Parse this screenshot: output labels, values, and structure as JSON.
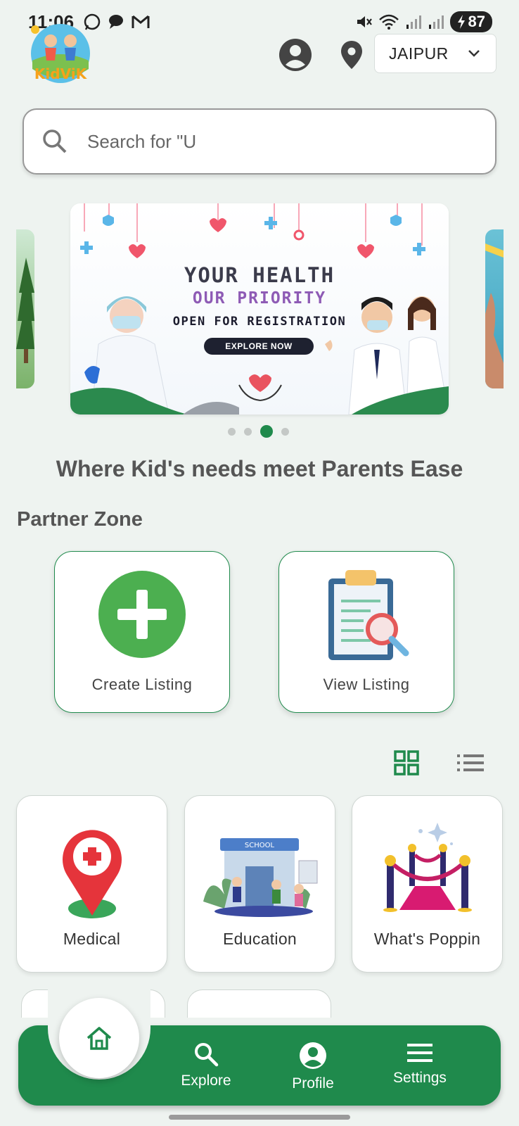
{
  "status_bar": {
    "time": "11:06",
    "battery": "87"
  },
  "header": {
    "logo_text": "KidViK",
    "city": "JAIPUR"
  },
  "search": {
    "placeholder": "Search for \"U"
  },
  "carousel": {
    "banner": {
      "title": "YOUR HEALTH",
      "subtitle": "OUR PRIORITY",
      "registration": "OPEN FOR REGISTRATION",
      "button": "EXPLORE NOW"
    },
    "dots": 4,
    "active_index": 2
  },
  "tagline": "Where Kid's needs meet Parents Ease",
  "partner_zone": {
    "title": "Partner Zone",
    "create_label": "Create Listing",
    "view_label": "View Listing"
  },
  "categories": [
    {
      "label": "Medical"
    },
    {
      "label": "Education"
    },
    {
      "label": "What's Poppin"
    }
  ],
  "school_sign": "SCHOOL",
  "bottom_nav": {
    "explore": "Explore",
    "profile": "Profile",
    "settings": "Settings"
  },
  "colors": {
    "primary": "#1f8a4c",
    "plus_circle": "#4caf50",
    "background": "#eef3f0"
  }
}
